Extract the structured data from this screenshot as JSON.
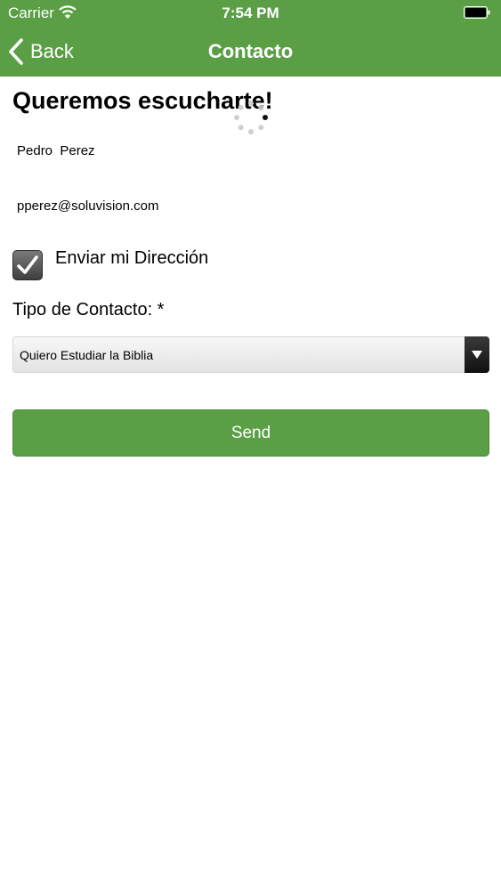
{
  "status_bar": {
    "carrier": "Carrier",
    "time": "7:54 PM"
  },
  "nav": {
    "back_label": "Back",
    "title": "Contacto"
  },
  "form": {
    "heading": "Queremos escucharte!",
    "name_value": "Pedro  Perez",
    "email_value": "pperez@soluvision.com",
    "send_address_label": "Enviar mi Dirección",
    "send_address_checked": true,
    "contact_type_label": "Tipo de Contacto: *",
    "contact_type_selected": "Quiero Estudiar la Biblia",
    "send_label": "Send"
  },
  "colors": {
    "accent": "#5a9f45"
  },
  "icons": {
    "wifi": "wifi-icon",
    "battery": "battery-icon",
    "back": "chevron-left-icon",
    "spinner": "loading-spinner-icon",
    "check": "checkmark-icon",
    "dropdown": "triangle-down-icon"
  }
}
